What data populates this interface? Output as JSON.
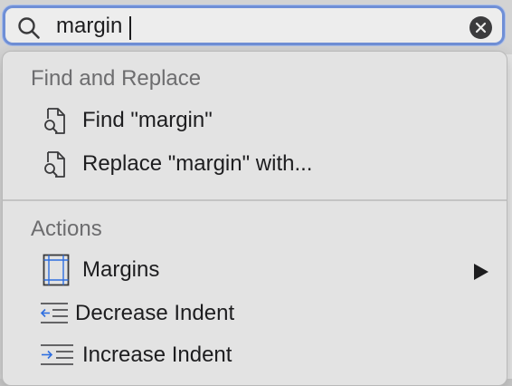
{
  "search": {
    "value": "margin",
    "clear_icon": "xmark-circle-icon",
    "search_icon": "magnifying-glass-icon"
  },
  "menu": {
    "sections": [
      {
        "header": "Find and Replace",
        "items": [
          {
            "label": "Find \"margin\"",
            "icon": "document-search-icon"
          },
          {
            "label": "Replace \"margin\" with...",
            "icon": "document-search-icon"
          }
        ]
      },
      {
        "header": "Actions",
        "items": [
          {
            "label": "Margins",
            "icon": "page-margins-icon",
            "has_submenu": true
          },
          {
            "label": "Decrease Indent",
            "icon": "decrease-indent-icon"
          },
          {
            "label": "Increase Indent",
            "icon": "increase-indent-icon"
          }
        ]
      }
    ]
  },
  "colors": {
    "focus_ring": "#6f8fd6",
    "menu_background": "#e3e3e3",
    "section_header": "#6d6d6f",
    "indent_arrow": "#2f6fe0"
  }
}
